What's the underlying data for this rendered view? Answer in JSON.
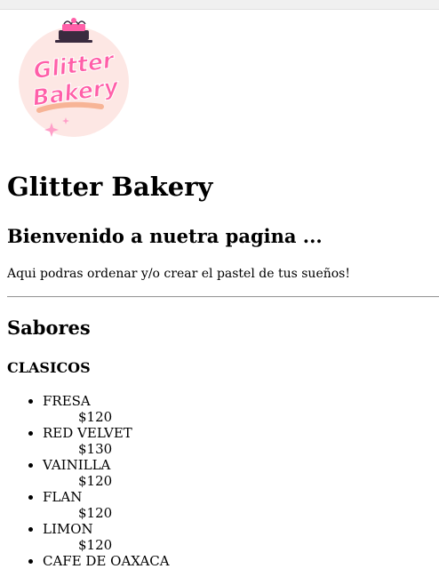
{
  "logo": {
    "line1": "Glitter",
    "line2": "Bakery"
  },
  "page": {
    "title": "Glitter Bakery",
    "welcome": "Bienvenido a nuetra pagina ...",
    "intro": "Aqui podras ordenar y/o crear el pastel de tus sueños!"
  },
  "section": {
    "title": "Sabores",
    "category": "CLASICOS",
    "flavors": [
      {
        "name": "FRESA",
        "price": "$120"
      },
      {
        "name": "RED VELVET",
        "price": "$130"
      },
      {
        "name": "VAINILLA",
        "price": "$120"
      },
      {
        "name": "FLAN",
        "price": "$120"
      },
      {
        "name": "LIMON",
        "price": "$120"
      },
      {
        "name": "CAFE DE OAXACA",
        "price": ""
      }
    ]
  },
  "colors": {
    "brand_pink": "#ff5fa8",
    "logo_bg": "#fde7e4",
    "accent_orange": "#f5a782",
    "cake_dark": "#3a2b3f"
  }
}
